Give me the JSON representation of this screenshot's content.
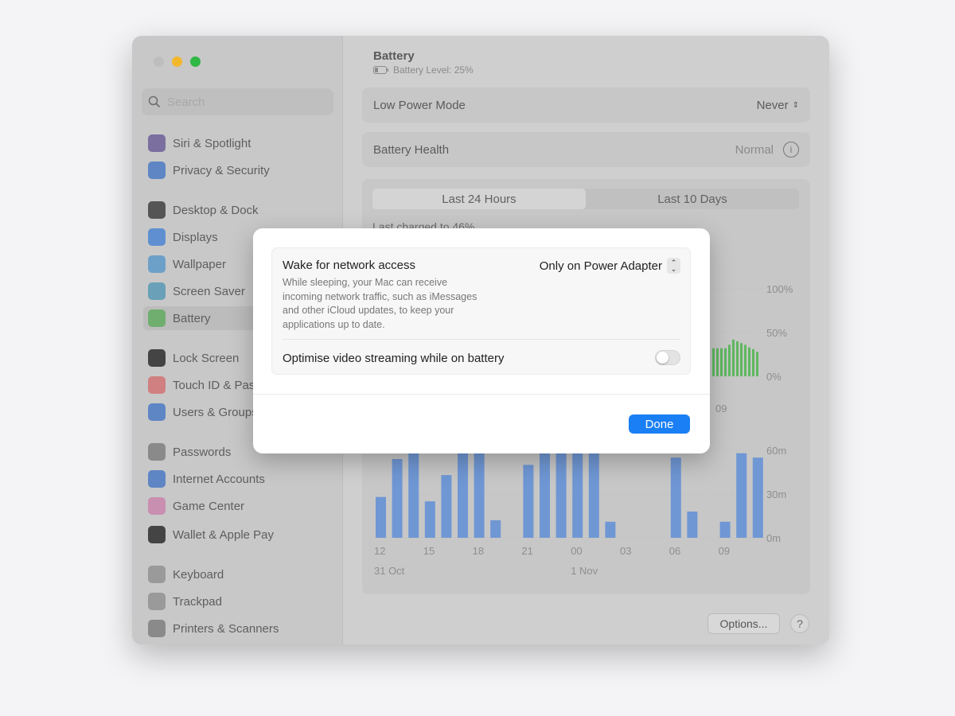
{
  "window": {
    "title": "Battery",
    "battery_level": "Battery Level: 25%"
  },
  "sidebar": {
    "search_placeholder": "Search",
    "items": [
      {
        "label": "Siri & Spotlight",
        "icon": "siri-icon",
        "color": "#7b6fa0"
      },
      {
        "label": "Privacy & Security",
        "icon": "hand-icon",
        "color": "#5f86c4"
      },
      {
        "label": "Desktop & Dock",
        "icon": "dock-icon",
        "color": "#555555"
      },
      {
        "label": "Displays",
        "icon": "sun-icon",
        "color": "#5f8fd0"
      },
      {
        "label": "Wallpaper",
        "icon": "flower-icon",
        "color": "#6da0c8"
      },
      {
        "label": "Screen Saver",
        "icon": "screensaver-icon",
        "color": "#6aa0b8"
      },
      {
        "label": "Battery",
        "icon": "battery-icon",
        "color": "#6fae6f",
        "active": true
      },
      {
        "label": "Lock Screen",
        "icon": "lock-icon",
        "color": "#444444"
      },
      {
        "label": "Touch ID & Password",
        "icon": "fingerprint-icon",
        "color": "#d08080"
      },
      {
        "label": "Users & Groups",
        "icon": "users-icon",
        "color": "#5f86c4"
      },
      {
        "label": "Passwords",
        "icon": "key-icon",
        "color": "#8a8a8a"
      },
      {
        "label": "Internet Accounts",
        "icon": "at-icon",
        "color": "#5f86c4"
      },
      {
        "label": "Game Center",
        "icon": "gamecenter-icon",
        "color": "#c88fb0"
      },
      {
        "label": "Wallet & Apple Pay",
        "icon": "wallet-icon",
        "color": "#444444"
      },
      {
        "label": "Keyboard",
        "icon": "keyboard-icon",
        "color": "#9a9a9a"
      },
      {
        "label": "Trackpad",
        "icon": "trackpad-icon",
        "color": "#9a9a9a"
      },
      {
        "label": "Printers & Scanners",
        "icon": "printer-icon",
        "color": "#8a8a8a"
      }
    ]
  },
  "main": {
    "low_power_label": "Low Power Mode",
    "low_power_value": "Never",
    "health_label": "Battery Health",
    "health_value": "Normal",
    "tabs": [
      "Last 24 Hours",
      "Last 10 Days"
    ],
    "last_charged": "Last charged to 46%",
    "options_label": "Options...",
    "help_label": "?"
  },
  "chart_data": [
    {
      "type": "bar",
      "ylabel": "",
      "yticks": [
        "100%",
        "50%",
        "0%"
      ],
      "ylim": [
        0,
        100
      ],
      "xticks_visible": [
        "09"
      ],
      "color": "#5fb860",
      "x": [
        "09:00",
        "09:15",
        "09:30",
        "09:45",
        "10:00",
        "10:15",
        "10:30",
        "10:45",
        "11:00",
        "11:15",
        "11:30",
        "11:45"
      ],
      "values": [
        32,
        32,
        32,
        32,
        36,
        42,
        40,
        38,
        36,
        33,
        31,
        28
      ]
    },
    {
      "type": "bar",
      "yticks": [
        "60m",
        "30m",
        "0m"
      ],
      "ylim": [
        0,
        60
      ],
      "color": "#6f97d4",
      "xticks": [
        "12",
        "15",
        "18",
        "21",
        "00",
        "03",
        "06",
        "09"
      ],
      "date_labels": [
        "31 Oct",
        "1 Nov"
      ],
      "categories": [
        "12",
        "13",
        "14",
        "15",
        "16",
        "17",
        "18",
        "19",
        "20",
        "21",
        "22",
        "23",
        "00",
        "01",
        "02",
        "03",
        "04",
        "05",
        "06",
        "07",
        "08",
        "09",
        "10",
        "11"
      ],
      "values": [
        28,
        54,
        60,
        25,
        43,
        60,
        60,
        12,
        0,
        50,
        60,
        60,
        60,
        60,
        11,
        0,
        0,
        0,
        55,
        18,
        0,
        11,
        58,
        55
      ]
    }
  ],
  "dialog": {
    "wake_title": "Wake for network access",
    "wake_desc": "While sleeping, your Mac can receive incoming network traffic, such as iMessages and other iCloud updates, to keep your applications up to date.",
    "wake_value": "Only on Power Adapter",
    "video_label": "Optimise video streaming while on battery",
    "video_enabled": false,
    "done_label": "Done",
    "accent": "#1a7ff5"
  }
}
